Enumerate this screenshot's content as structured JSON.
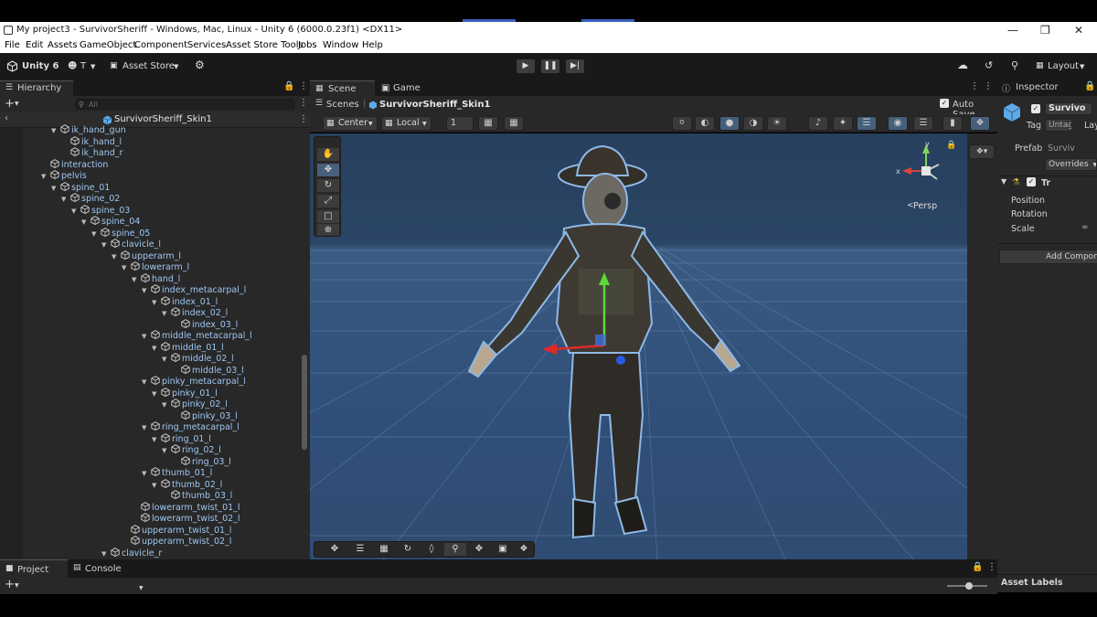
{
  "window": {
    "title": "My project3 - SurvivorSheriff - Windows, Mac, Linux - Unity 6 (6000.0.23f1) <DX11>"
  },
  "menu": [
    "File",
    "Edit",
    "Assets",
    "GameObject",
    "Component",
    "Services",
    "Asset Store Tools",
    "Jobs",
    "Window",
    "Help"
  ],
  "toolbar": {
    "unity_label": "Unity 6",
    "account_label": "T",
    "asset_store_label": "Asset Store",
    "layout_label": "Layout"
  },
  "hierarchy": {
    "tab_label": "Hierarchy",
    "search_placeholder": "All",
    "scene_name": "SurvivorSheriff_Skin1",
    "nodes": [
      {
        "label": "ik_hand_gun",
        "depth": 5,
        "fold": "down"
      },
      {
        "label": "ik_hand_l",
        "depth": 6,
        "fold": ""
      },
      {
        "label": "ik_hand_r",
        "depth": 6,
        "fold": ""
      },
      {
        "label": "interaction",
        "depth": 4,
        "fold": ""
      },
      {
        "label": "pelvis",
        "depth": 4,
        "fold": "down"
      },
      {
        "label": "spine_01",
        "depth": 5,
        "fold": "down"
      },
      {
        "label": "spine_02",
        "depth": 6,
        "fold": "down"
      },
      {
        "label": "spine_03",
        "depth": 7,
        "fold": "down"
      },
      {
        "label": "spine_04",
        "depth": 8,
        "fold": "down"
      },
      {
        "label": "spine_05",
        "depth": 9,
        "fold": "down"
      },
      {
        "label": "clavicle_l",
        "depth": 10,
        "fold": "down"
      },
      {
        "label": "upperarm_l",
        "depth": 11,
        "fold": "down"
      },
      {
        "label": "lowerarm_l",
        "depth": 12,
        "fold": "down"
      },
      {
        "label": "hand_l",
        "depth": 13,
        "fold": "down"
      },
      {
        "label": "index_metacarpal_l",
        "depth": 14,
        "fold": "down"
      },
      {
        "label": "index_01_l",
        "depth": 15,
        "fold": "down"
      },
      {
        "label": "index_02_l",
        "depth": 16,
        "fold": "down"
      },
      {
        "label": "index_03_l",
        "depth": 17,
        "fold": ""
      },
      {
        "label": "middle_metacarpal_l",
        "depth": 14,
        "fold": "down"
      },
      {
        "label": "middle_01_l",
        "depth": 15,
        "fold": "down"
      },
      {
        "label": "middle_02_l",
        "depth": 16,
        "fold": "down"
      },
      {
        "label": "middle_03_l",
        "depth": 17,
        "fold": ""
      },
      {
        "label": "pinky_metacarpal_l",
        "depth": 14,
        "fold": "down"
      },
      {
        "label": "pinky_01_l",
        "depth": 15,
        "fold": "down"
      },
      {
        "label": "pinky_02_l",
        "depth": 16,
        "fold": "down"
      },
      {
        "label": "pinky_03_l",
        "depth": 17,
        "fold": ""
      },
      {
        "label": "ring_metacarpal_l",
        "depth": 14,
        "fold": "down"
      },
      {
        "label": "ring_01_l",
        "depth": 15,
        "fold": "down"
      },
      {
        "label": "ring_02_l",
        "depth": 16,
        "fold": "down"
      },
      {
        "label": "ring_03_l",
        "depth": 17,
        "fold": ""
      },
      {
        "label": "thumb_01_l",
        "depth": 14,
        "fold": "down"
      },
      {
        "label": "thumb_02_l",
        "depth": 15,
        "fold": "down"
      },
      {
        "label": "thumb_03_l",
        "depth": 16,
        "fold": ""
      },
      {
        "label": "lowerarm_twist_01_l",
        "depth": 13,
        "fold": ""
      },
      {
        "label": "lowerarm_twist_02_l",
        "depth": 13,
        "fold": ""
      },
      {
        "label": "upperarm_twist_01_l",
        "depth": 12,
        "fold": ""
      },
      {
        "label": "upperarm_twist_02_l",
        "depth": 12,
        "fold": ""
      },
      {
        "label": "clavicle_r",
        "depth": 10,
        "fold": "down"
      }
    ]
  },
  "scene": {
    "tab_scene": "Scene",
    "tab_game": "Game",
    "breadcrumb_scenes": "Scenes",
    "breadcrumb_object": "SurvivorSheriff_Skin1",
    "auto_save": "Auto Save",
    "pivot": "Center",
    "space": "Local",
    "grid_snap_value": "1",
    "persp_label": "Persp",
    "gizmo_x": "x",
    "gizmo_y": "y"
  },
  "inspector": {
    "tab_label": "Inspector",
    "object_name": "Survivo",
    "tag_label": "Tag",
    "tag_value": "Untag",
    "layer_label": "Lay",
    "prefab_label": "Prefab",
    "prefab_value": "Surviv",
    "overrides_label": "Overrides",
    "transform_label": "Tr",
    "position_label": "Position",
    "rotation_label": "Rotation",
    "scale_label": "Scale",
    "add_component": "Add Compon",
    "asset_labels": "Asset Labels"
  },
  "bottom": {
    "tab_project": "Project",
    "tab_console": "Console"
  },
  "colors": {
    "editor_bg": "#282828",
    "toolbar_bg": "#191919",
    "scene_sky": "#27405e",
    "scene_ground": "#31507a",
    "hierarchy_text": "#9ec7f2",
    "active_button": "#46607c"
  }
}
